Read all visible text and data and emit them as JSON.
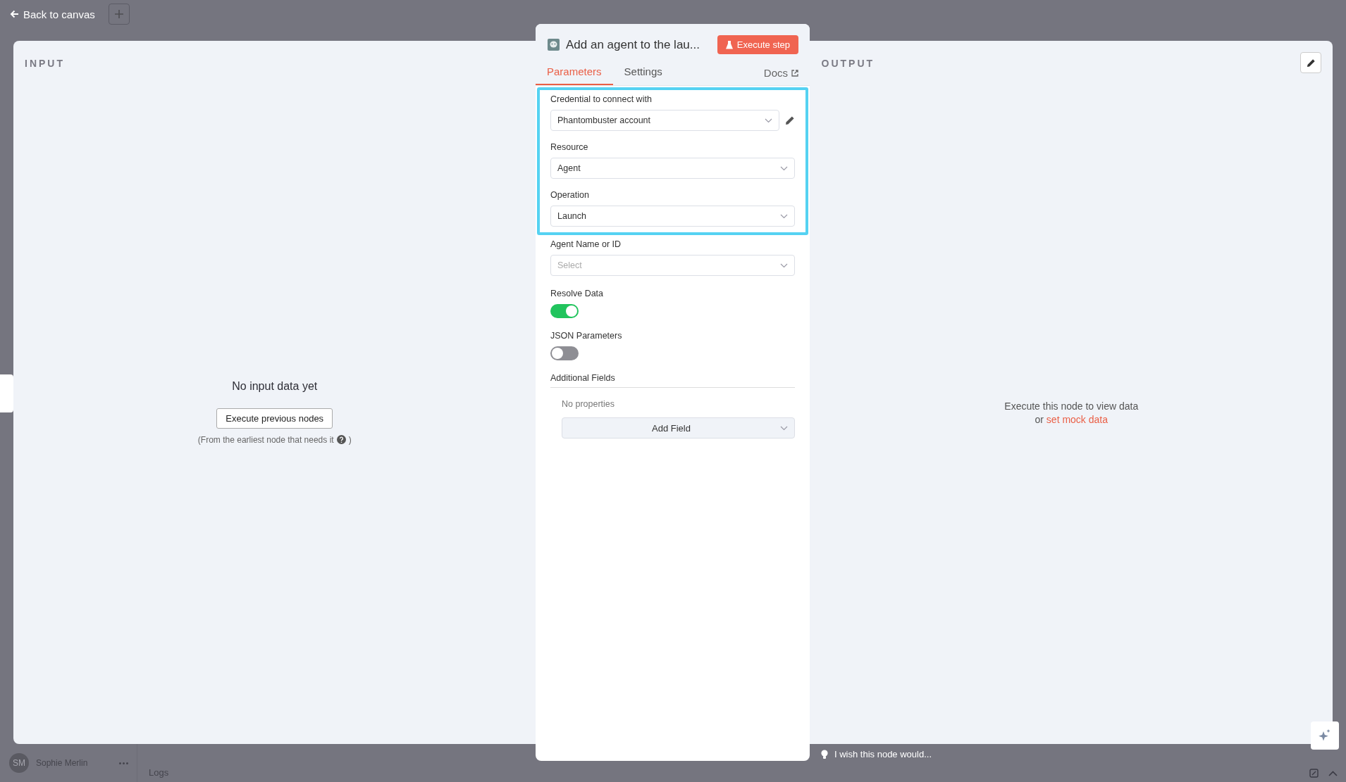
{
  "header": {
    "back_link": "Back to canvas"
  },
  "sidebar": {
    "user": {
      "initials": "SM",
      "name": "Sophie Merlin"
    }
  },
  "logs": {
    "label": "Logs"
  },
  "input_panel": {
    "title": "INPUT",
    "empty_title": "No input data yet",
    "button": "Execute previous nodes",
    "hint": "(From the earliest node that needs it",
    "hint_end": ")"
  },
  "node": {
    "title": "Add an agent to the lau...",
    "execute_button": "Execute step",
    "tabs": [
      {
        "label": "Parameters",
        "selected": true
      },
      {
        "label": "Settings",
        "selected": false
      }
    ],
    "docs_link": "Docs",
    "highlighted_fields": [
      {
        "kind": "credential",
        "label": "Credential to connect with",
        "value": "Phantombuster account"
      },
      {
        "kind": "select",
        "label": "Resource",
        "value": "Agent"
      },
      {
        "kind": "select",
        "label": "Operation",
        "value": "Launch"
      }
    ],
    "fields": [
      {
        "kind": "select",
        "label": "Agent Name or ID",
        "placeholder": "Select"
      },
      {
        "kind": "toggle",
        "label": "Resolve Data",
        "on": true
      },
      {
        "kind": "toggle",
        "label": "JSON Parameters",
        "on": false
      }
    ],
    "additional": {
      "title": "Additional Fields",
      "empty": "No properties",
      "add_button": "Add Field"
    }
  },
  "output_panel": {
    "title": "OUTPUT",
    "message": "Execute this node to view data",
    "or": "or",
    "link": "set mock data"
  },
  "feedback": {
    "text": "I wish this node would..."
  }
}
